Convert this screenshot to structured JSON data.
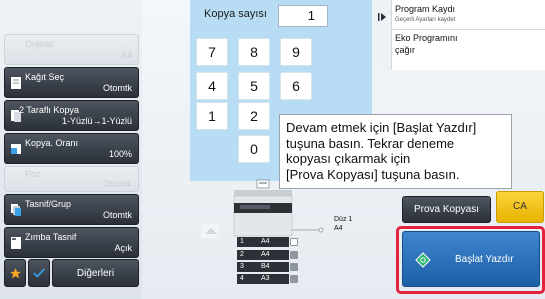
{
  "left_panel": {
    "items": [
      {
        "label": "Orijinal",
        "value": "A4",
        "enabled": false
      },
      {
        "label": "Kağıt Seç",
        "value": "Otomtk",
        "enabled": true
      },
      {
        "label": "2 Taraflı Kopya",
        "value": "1-Yüzlü→1-Yüzlü",
        "enabled": true
      },
      {
        "label": "Kopya. Oranı",
        "value": "100%",
        "enabled": true
      },
      {
        "label": "Poz",
        "value": "Otomtk",
        "enabled": false
      },
      {
        "label": "Tasnif/Grup",
        "value": "Otomtk",
        "enabled": true
      },
      {
        "label": "Zımba Tasnif",
        "value": "Açık",
        "enabled": true
      }
    ],
    "others_label": "Diğerleri"
  },
  "keypad": {
    "label": "Kopya sayısı",
    "value": "1",
    "keys": [
      "7",
      "8",
      "9",
      "4",
      "5",
      "6",
      "1",
      "2",
      "0"
    ]
  },
  "program": {
    "item1_title": "Program Kaydı",
    "item1_subtitle": "Geçerli Ayarları kaydet",
    "item2_title": "Eko Programını",
    "item2_subtitle": "çağır"
  },
  "tooltip": {
    "lines": [
      "Devam etmek için [Başlat Yazdır]",
      "tuşuna basın. Tekrar deneme",
      "kopyası çıkarmak için",
      "[Prova Kopyası] tuşuna basın."
    ]
  },
  "machine": {
    "bypass_label": "Düz 1",
    "bypass_size": "A4",
    "trays": [
      {
        "num": "1",
        "size": "A4",
        "selected": true
      },
      {
        "num": "2",
        "size": "A4",
        "selected": false
      },
      {
        "num": "3",
        "size": "B4",
        "selected": false
      },
      {
        "num": "4",
        "size": "A3",
        "selected": false
      }
    ]
  },
  "buttons": {
    "prova": "Prova Kopyası",
    "ca": "CA",
    "start": "Başlat Yazdır"
  },
  "colors": {
    "keypad_bg": "#b8dcf3",
    "start_blue": "#1c5fa5",
    "start_outline": "#e3233b",
    "ca_yellow": "#f7c51a",
    "star_orange": "#f5a623",
    "check_blue": "#3aa0e8"
  }
}
